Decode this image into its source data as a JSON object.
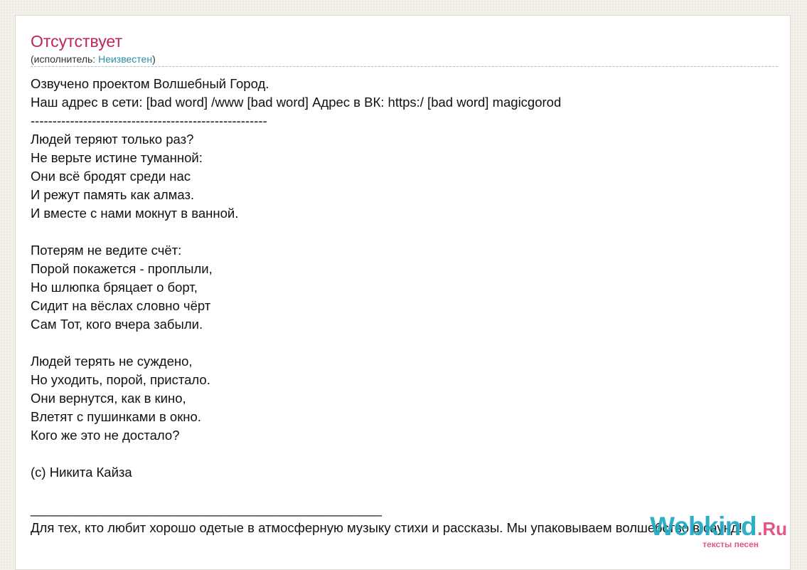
{
  "song": {
    "title": "Отсутствует",
    "artist_prefix": "(исполнитель: ",
    "artist_name": "Неизвестен",
    "artist_suffix": ")"
  },
  "lyrics": [
    "Озвучено проектом Волшебный Город.",
    "Наш адрес в сети: [bad word] /www [bad word] Адрес в ВК: https:/ [bad word] magicgorod",
    "------------------------------------------------------",
    "Людей теряют только раз?",
    "Не верьте истине туманной:",
    "Они всё бродят среди нас",
    "И режут память как алмаз.",
    "И вместе с нами мокнут в ванной.",
    "",
    "Потерям не ведите счёт:",
    "Порой покажется - проплыли,",
    "Но шлюпка бряцает о борт,",
    "Сидит на вёслах словно чёрт",
    "Сам Тот, кого вчера забыли.",
    "",
    "Людей терять не суждено,",
    "Но уходить, порой, пристало.",
    "Они вернутся, как в кино,",
    "Влетят с пушинками в окно.",
    "Кого же это не достало?",
    "",
    "(с) Никита Кайза",
    "",
    "________________________________________________",
    "Для тех, кто любит хорошо одетые в атмосферную музыку стихи и рассказы. Мы упаковываем волшебство в саунд!"
  ],
  "watermark": {
    "brand": "Webkind",
    "tld": ".Ru",
    "tagline": "тексты песен"
  },
  "colors": {
    "title": "#c0245a",
    "link": "#2a8fa3",
    "watermark_main": "#1fa9c3",
    "watermark_accent": "#e4568a"
  }
}
